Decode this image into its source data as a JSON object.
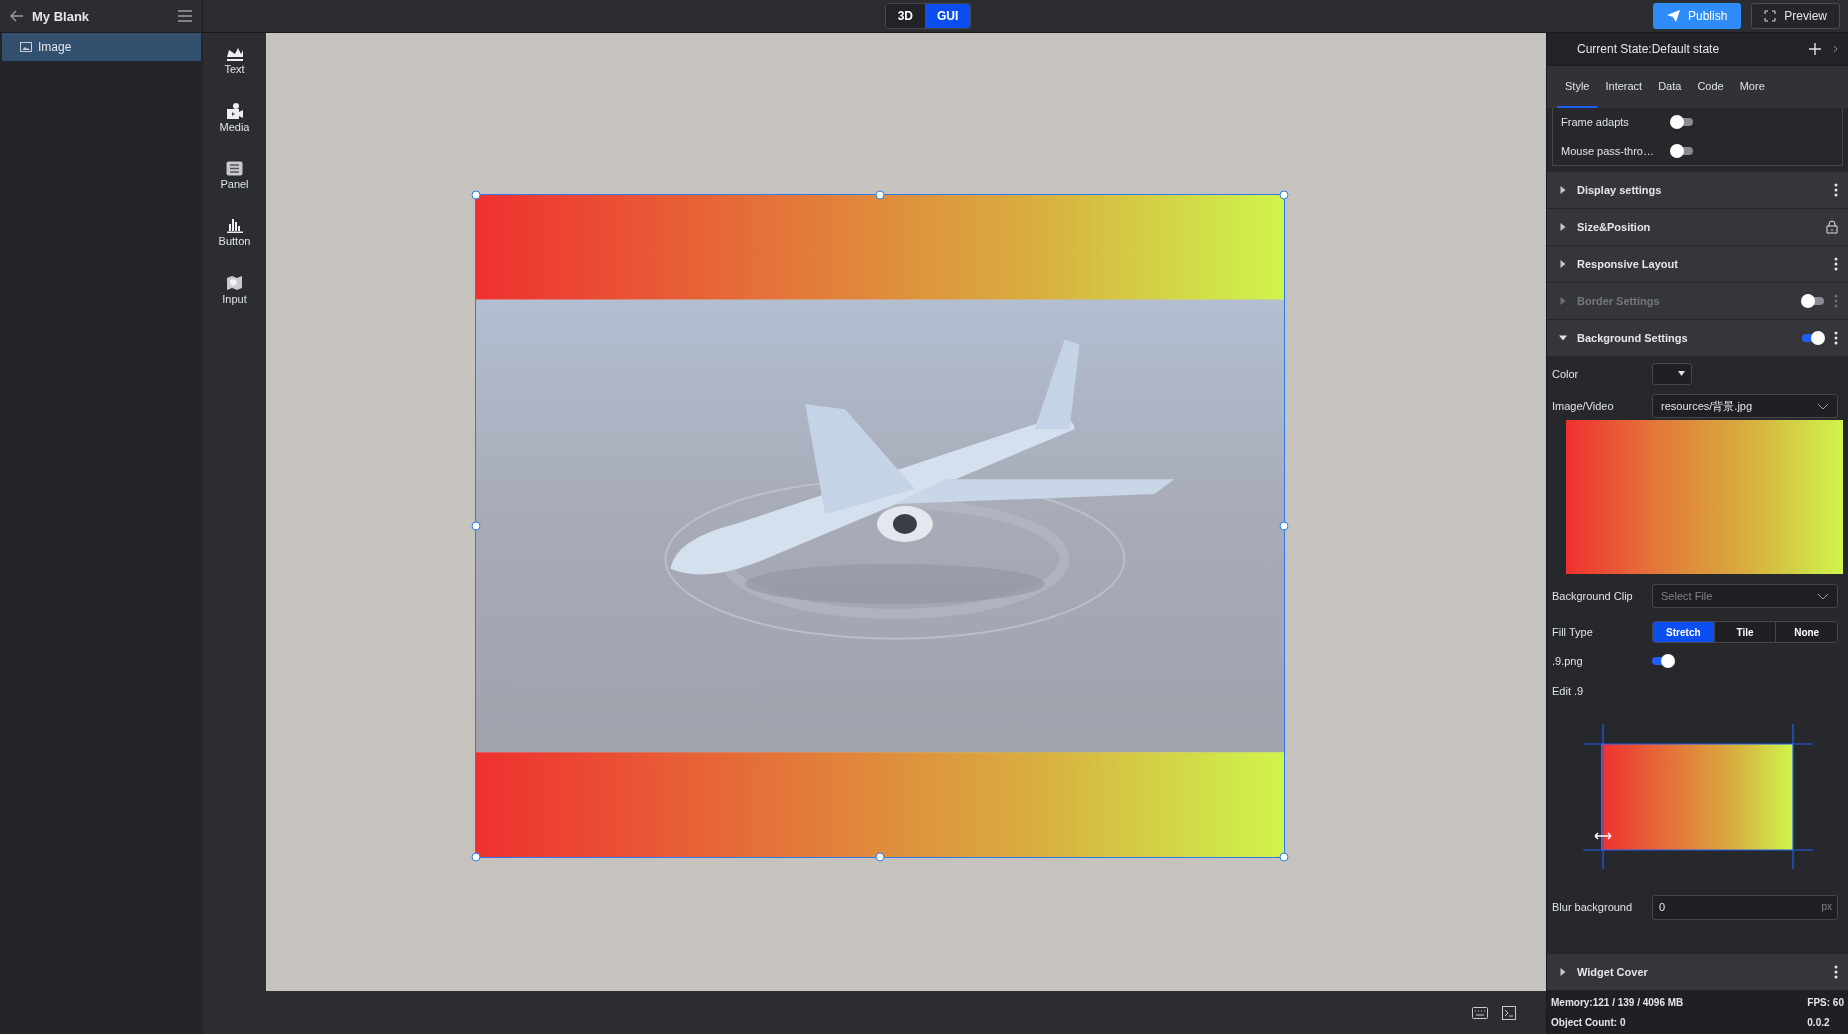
{
  "project": {
    "title": "My Blank"
  },
  "layers": [
    {
      "label": "Image",
      "selected": true
    }
  ],
  "toolbox": [
    {
      "label": "Text"
    },
    {
      "label": "Media"
    },
    {
      "label": "Panel"
    },
    {
      "label": "Button"
    },
    {
      "label": "Input"
    }
  ],
  "mode_switch": [
    {
      "label": "3D",
      "selected": false
    },
    {
      "label": "GUI",
      "selected": true
    }
  ],
  "actions": {
    "publish": "Publish",
    "preview": "Preview"
  },
  "canvas": {
    "kind": "picture",
    "selected": true
  },
  "inspector": {
    "state_title": "Current State:Default state",
    "tabs": [
      {
        "label": "Style",
        "selected": true
      },
      {
        "label": "Interact",
        "selected": false
      },
      {
        "label": "Data",
        "selected": false
      },
      {
        "label": "Code",
        "selected": false
      },
      {
        "label": "More",
        "selected": false
      }
    ],
    "toggles": [
      {
        "label": "Frame adapts",
        "on": false
      },
      {
        "label": "Mouse pass-thro…",
        "on": false
      }
    ],
    "sections": [
      {
        "title": "Display settings",
        "kind": "menu",
        "expanded": false,
        "disabled": false
      },
      {
        "title": "Size&Position",
        "kind": "lock",
        "expanded": false,
        "disabled": false
      },
      {
        "title": "Responsive Layout",
        "kind": "menu",
        "expanded": false,
        "disabled": false
      },
      {
        "title": "Border Settings",
        "kind": "toggle",
        "on": false,
        "expanded": false,
        "disabled": true
      },
      {
        "title": "Background Settings",
        "kind": "toggle",
        "on": true,
        "expanded": true,
        "disabled": false
      }
    ],
    "background": {
      "color_label": "Color",
      "image_label": "Image/Video",
      "image_value": "resources/背景.jpg",
      "clip_label": "Background Clip",
      "clip_placeholder": "Select File",
      "fill_label": "Fill Type",
      "fill_options": [
        {
          "label": "Stretch",
          "selected": true
        },
        {
          "label": "Tile",
          "selected": false
        },
        {
          "label": "None",
          "selected": false
        }
      ],
      "ninepatch_label": ".9.png",
      "ninepatch_on": true,
      "edit_label": "Edit .9",
      "blur_label": "Blur background",
      "blur_value": "0",
      "blur_unit": "px"
    },
    "sections_after": [
      {
        "title": "Widget Cover",
        "kind": "menu",
        "expanded": false,
        "disabled": false
      }
    ]
  },
  "status": {
    "memory": "Memory:121 / 139 / 4096 MB",
    "fps": "FPS: 60",
    "objects": "Object Count: 0",
    "version": "0.0.2"
  }
}
